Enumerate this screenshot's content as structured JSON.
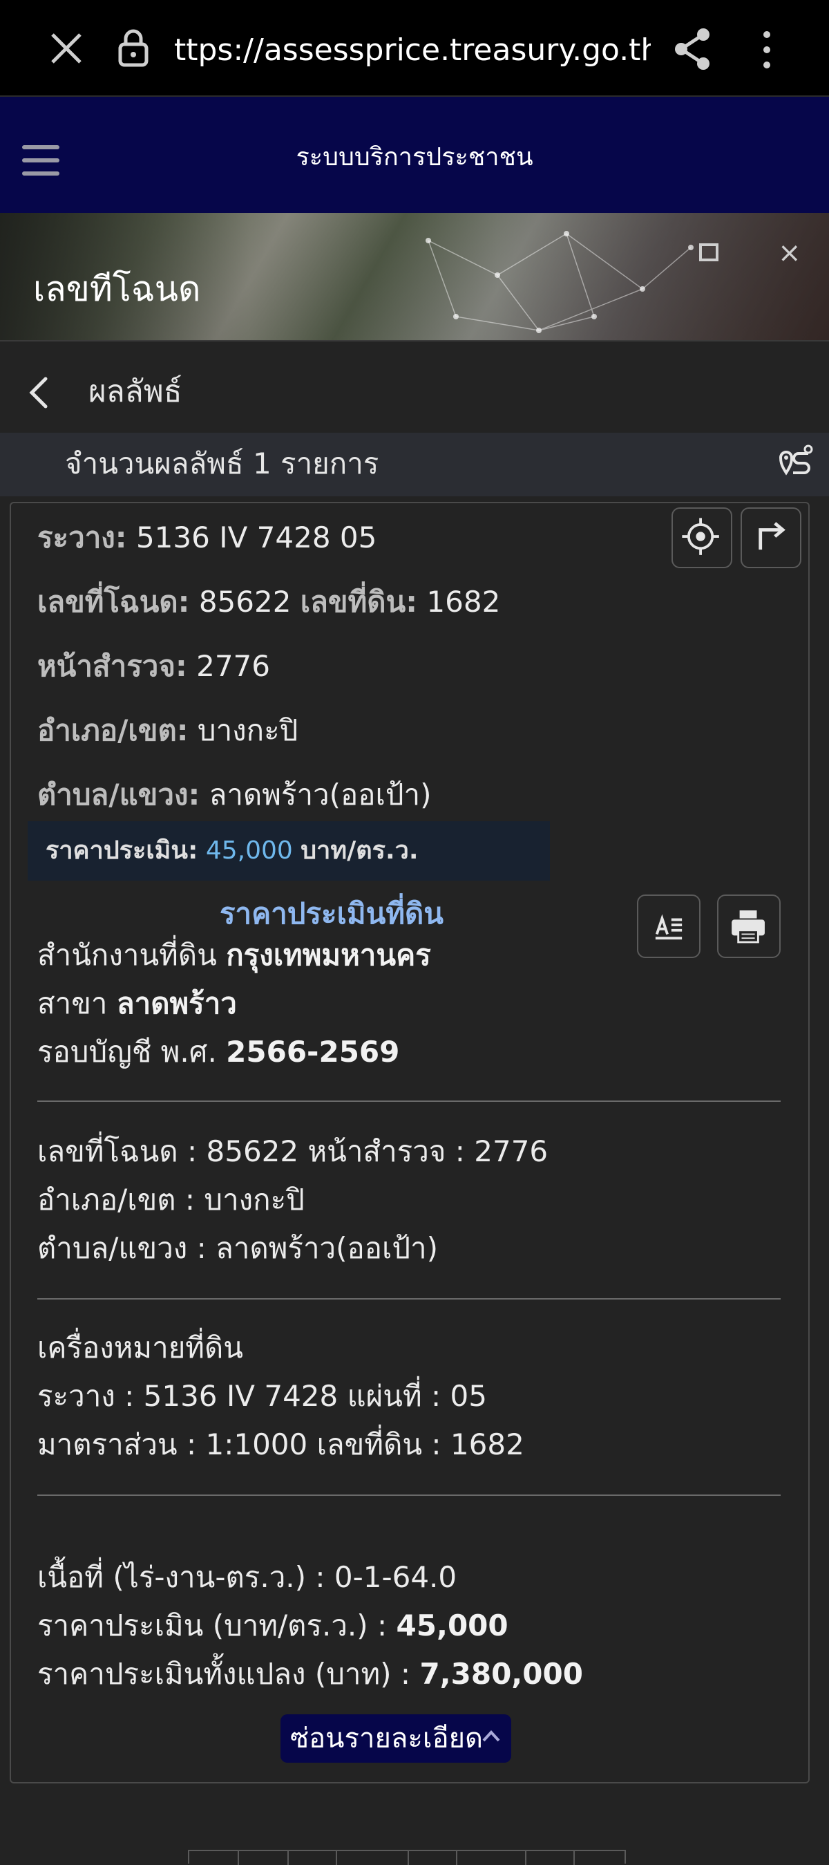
{
  "browser": {
    "url": "ttps://assessprice.treasury.go.th/",
    "icons": {
      "close": "close-icon",
      "lock": "lock-icon",
      "share": "share-icon",
      "menu": "more-vert-icon"
    }
  },
  "app": {
    "title": "ระบบบริการประชาชน",
    "banner_title": "เลขทีโฉนด"
  },
  "results": {
    "title": "ผลลัพธ์",
    "count_text": "จำนวนผลลัพธ์ 1 รายการ"
  },
  "summary": {
    "rawang_label": "ระวาง:",
    "rawang_value": "5136 IV 7428 05",
    "deed_label": "เลขที่โฉนด:",
    "deed_value": "85622",
    "land_no_label": "เลขที่ดิน:",
    "land_no_value": "1682",
    "survey_label": "หน้าสำรวจ:",
    "survey_value": "2776",
    "district_label": "อำเภอ/เขต:",
    "district_value": "บางกะปิ",
    "subdistrict_label": "ตำบล/แขวง:",
    "subdistrict_value": "ลาดพร้าว(ออเป้า)",
    "price_label": "ราคาประเมิน:",
    "price_value": "45,000",
    "price_unit": "บาท/ตร.ว."
  },
  "detail": {
    "section_title": "ราคาประเมินที่ดิน",
    "office_label": "สำนักงานที่ดิน",
    "office_value": "กรุงเทพมหานคร",
    "branch_label": "สาขา",
    "branch_value": "ลาดพร้าว",
    "period_label": "รอบบัญชี พ.ศ.",
    "period_value": "2566-2569",
    "line_deed": "เลขที่โฉนด : 85622 หน้าสำรวจ : 2776",
    "line_district": "อำเภอ/เขต : บางกะปิ",
    "line_subdistrict": "ตำบล/แขวง : ลาดพร้าว(ออเป้า)",
    "marker_title": "เครื่องหมายที่ดิน",
    "line_rawang": "ระวาง : 5136 IV 7428 แผ่นที่ : 05",
    "line_scale": "มาตราส่วน : 1:1000 เลขที่ดิน : 1682",
    "area_line": "เนื้อที่ (ไร่-งาน-ตร.ว.) : 0-1-64.0",
    "unit_price_label": "ราคาประเมิน (บาท/ตร.ว.) :",
    "unit_price_value": "45,000",
    "total_price_label": "ราคาประเมินทั้งแปลง (บาท) :",
    "total_price_value": "7,380,000",
    "toggle_label": "ซ่อนรายละเอียด"
  },
  "colors": {
    "header_bg": "#06064a",
    "page_bg": "#232323",
    "price_accent": "#6fb8ec",
    "section_title": "#8fb8f0"
  }
}
